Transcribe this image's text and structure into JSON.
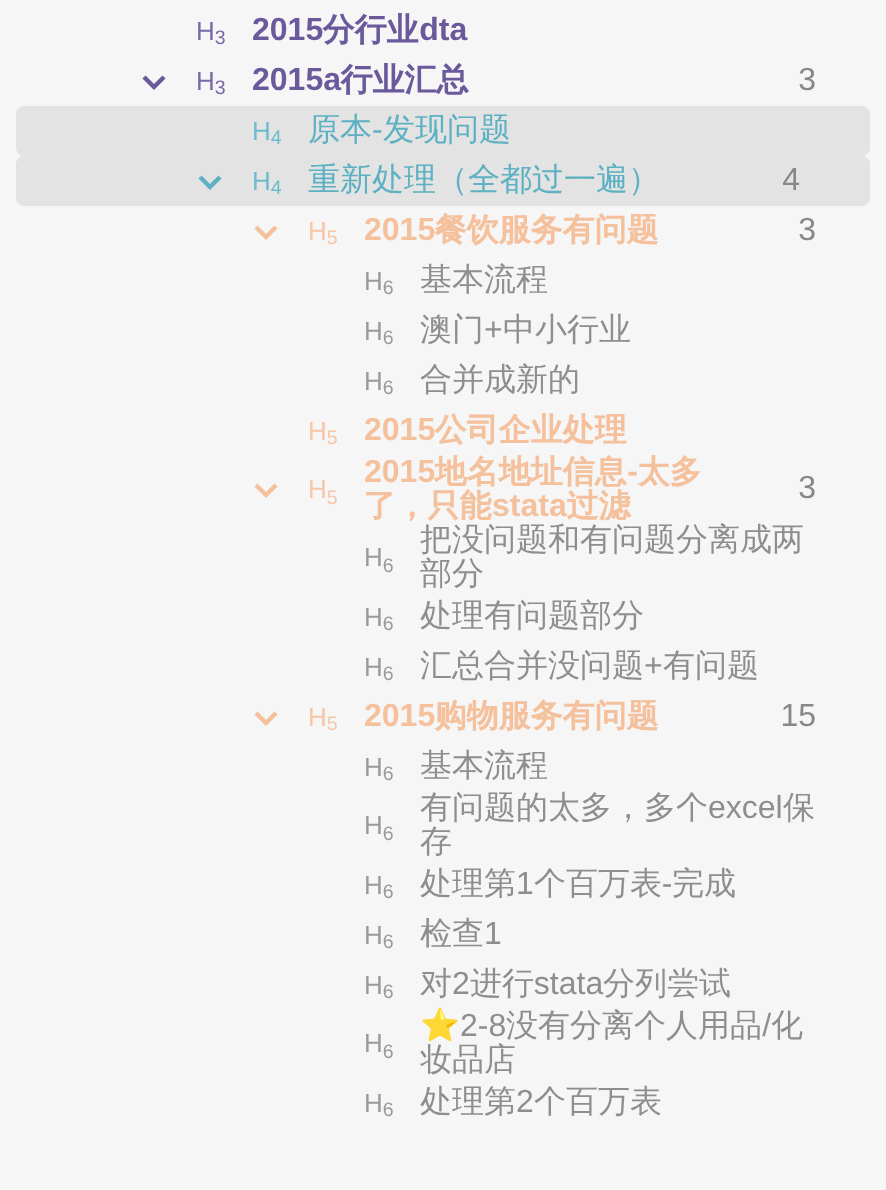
{
  "outline": [
    {
      "tag": "H$_{3}$",
      "kind": "h3",
      "text": "2015分行业dta",
      "highlighted": false
    },
    {
      "tag": "H$_{3}$",
      "kind": "h3",
      "text": "2015a行业汇总",
      "count": "3",
      "expanded": true,
      "highlighted": false,
      "children": [
        {
          "tag": "H$_{4}$",
          "kind": "h4",
          "text": "原本-发现问题",
          "highlighted": true
        },
        {
          "tag": "H$_{4}$",
          "kind": "h4",
          "text": "重新处理（全都过一遍）",
          "count": "4",
          "expanded": true,
          "highlighted": true,
          "children": [
            {
              "tag": "H$_{5}$",
              "kind": "h5",
              "text": "2015餐饮服务有问题",
              "count": "3",
              "expanded": true,
              "highlighted": false,
              "children": [
                {
                  "tag": "H$_{6}$",
                  "kind": "h6",
                  "text": "基本流程",
                  "highlighted": false
                },
                {
                  "tag": "H$_{6}$",
                  "kind": "h6",
                  "text": "澳门+中小行业",
                  "highlighted": false
                },
                {
                  "tag": "H$_{6}$",
                  "kind": "h6",
                  "text": "合并成新的",
                  "highlighted": false
                }
              ]
            },
            {
              "tag": "H$_{5}$",
              "kind": "h5",
              "text": "2015公司企业处理",
              "highlighted": false
            },
            {
              "tag": "H$_{5}$",
              "kind": "h5",
              "text": "2015地名地址信息-太多了，只能stata过滤",
              "count": "3",
              "expanded": true,
              "highlighted": false,
              "children": [
                {
                  "tag": "H$_{6}$",
                  "kind": "h6",
                  "text": "把没问题和有问题分离成两部分",
                  "highlighted": false
                },
                {
                  "tag": "H$_{6}$",
                  "kind": "h6",
                  "text": "处理有问题部分",
                  "highlighted": false
                },
                {
                  "tag": "H$_{6}$",
                  "kind": "h6",
                  "text": "汇总合并没问题+有问题",
                  "highlighted": false
                }
              ]
            },
            {
              "tag": "H$_{5}$",
              "kind": "h5",
              "text": "2015购物服务有问题",
              "count": "15",
              "expanded": true,
              "highlighted": false,
              "children": [
                {
                  "tag": "H$_{6}$",
                  "kind": "h6",
                  "text": "基本流程",
                  "highlighted": false
                },
                {
                  "tag": "H$_{6}$",
                  "kind": "h6",
                  "text": "有问题的太多，多个excel保存",
                  "highlighted": false
                },
                {
                  "tag": "H$_{6}$",
                  "kind": "h6",
                  "text": "处理第1个百万表-完成",
                  "highlighted": false
                },
                {
                  "tag": "H$_{6}$",
                  "kind": "h6",
                  "text": "检查1",
                  "highlighted": false
                },
                {
                  "tag": "H$_{6}$",
                  "kind": "h6",
                  "text": "对2进行stata分列尝试",
                  "highlighted": false
                },
                {
                  "tag": "H$_{6}$",
                  "kind": "h6",
                  "text": "⭐2-8没有分离个人用品/化妆品店",
                  "highlighted": false
                },
                {
                  "tag": "H$_{6}$",
                  "kind": "h6",
                  "text": "处理第2个百万表",
                  "highlighted": false
                }
              ]
            }
          ]
        }
      ]
    }
  ]
}
